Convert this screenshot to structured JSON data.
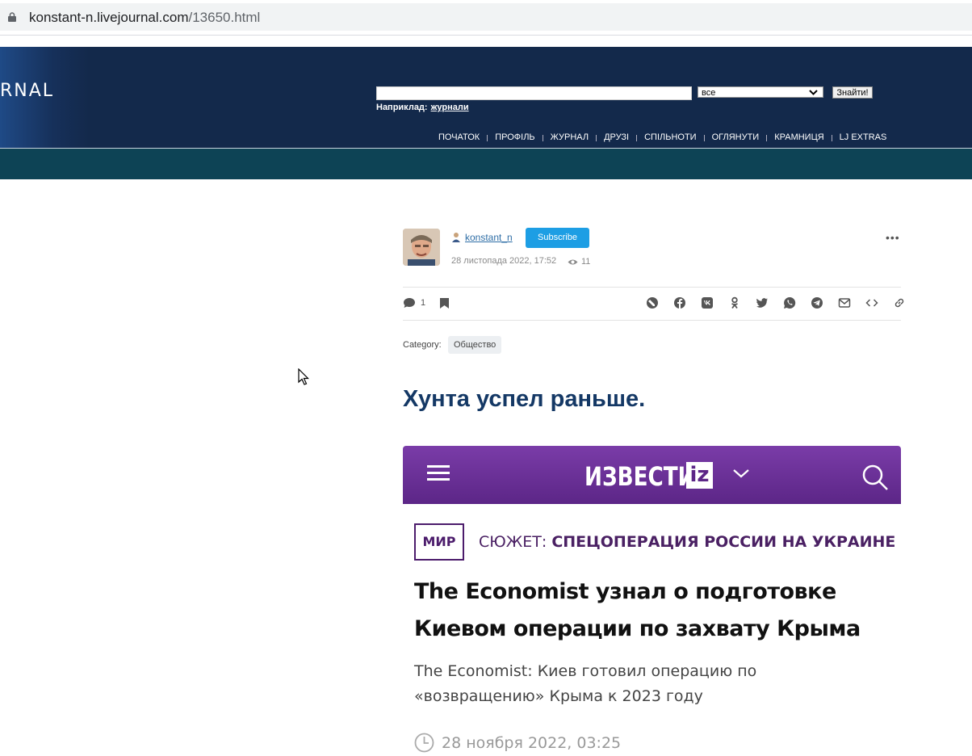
{
  "browser": {
    "url_host": "konstant-n.livejournal.com",
    "url_path": "/13650.html"
  },
  "header": {
    "logo_text": "RNAL",
    "search_placeholder": "",
    "scope_select": "все",
    "search_button": "Знайти!",
    "example_label": "Наприклад:",
    "example_link": "журнали",
    "nav": [
      "ПОЧАТОК",
      "ПРОФІЛЬ",
      "ЖУРНАЛ",
      "ДРУЗІ",
      "СПІЛЬНОТИ",
      "ОГЛЯНУТИ",
      "КРАМНИЦЯ",
      "LJ EXTRAS"
    ]
  },
  "post": {
    "username": "konstant_n",
    "subscribe_label": "Subscribe",
    "more_label": "•••",
    "datetime": "28 листопада 2022, 17:52",
    "views": "11",
    "comments_count": "1",
    "category_label": "Category:",
    "category_value": "Общество",
    "title": "Хунта успел раньше."
  },
  "share_icons": [
    "livejournal-icon",
    "facebook-icon",
    "vk-icon",
    "odnoklassniki-icon",
    "twitter-icon",
    "whatsapp-icon",
    "telegram-icon",
    "email-icon",
    "embed-icon",
    "link-icon"
  ],
  "embed": {
    "brand": "ИЗВЕСТИЯ",
    "brand_badge": "iz",
    "section": "МИР",
    "story_label": "СЮЖЕТ:",
    "story_title": "СПЕЦОПЕРАЦИЯ РОССИИ НА УКРАИНЕ",
    "headline": "The Economist узнал о подготовке Киевом операции по захвату Крыма",
    "lead": "The Economist: Киев готовил операцию по «возвращению» Крыма к 2023 году",
    "date": "28 ноября 2022, 03:25"
  },
  "colors": {
    "header_bg": "#13294b",
    "teal_bar": "#0d4355",
    "subscribe_bg": "#1d9ee4",
    "title": "#143865",
    "izvestia_purple": "#5c2687"
  }
}
